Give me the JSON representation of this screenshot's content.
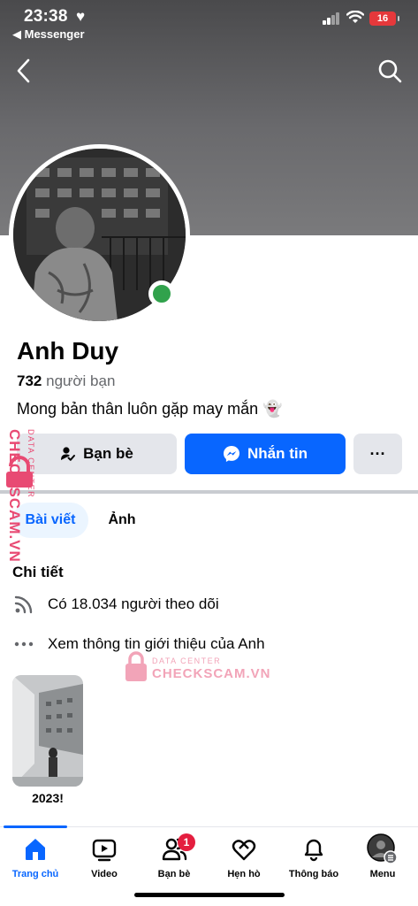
{
  "status_bar": {
    "time": "23:38",
    "back_app": "◀ Messenger",
    "battery": "16"
  },
  "profile": {
    "name": "Anh Duy",
    "friend_count": "732",
    "friend_label": "người bạn",
    "bio": "Mong bản thân luôn gặp may mắn 👻"
  },
  "actions": {
    "friends_label": "Bạn bè",
    "message_label": "Nhắn tin",
    "more_label": "···"
  },
  "tabs": [
    {
      "label": "Bài viết",
      "active": true
    },
    {
      "label": "Ảnh",
      "active": false
    }
  ],
  "details": {
    "title": "Chi tiết",
    "followers": "Có 18.034 người theo dõi",
    "intro": "Xem thông tin giới thiệu của Anh"
  },
  "featured": {
    "label": "2023!"
  },
  "watermark": {
    "top": "DATA CENTER",
    "main": "CHECKSCAM.VN"
  },
  "bottom_nav": [
    {
      "label": "Trang chủ",
      "icon": "home-icon",
      "active": true
    },
    {
      "label": "Video",
      "icon": "video-icon"
    },
    {
      "label": "Bạn bè",
      "icon": "friends-icon",
      "badge": "1"
    },
    {
      "label": "Hẹn hò",
      "icon": "dating-icon"
    },
    {
      "label": "Thông báo",
      "icon": "bell-icon"
    },
    {
      "label": "Menu",
      "icon": "menu-avatar-icon"
    }
  ],
  "colors": {
    "accent": "#0866ff",
    "online": "#31a24c",
    "badge": "#e41e3f",
    "watermark": "#e84a73"
  }
}
